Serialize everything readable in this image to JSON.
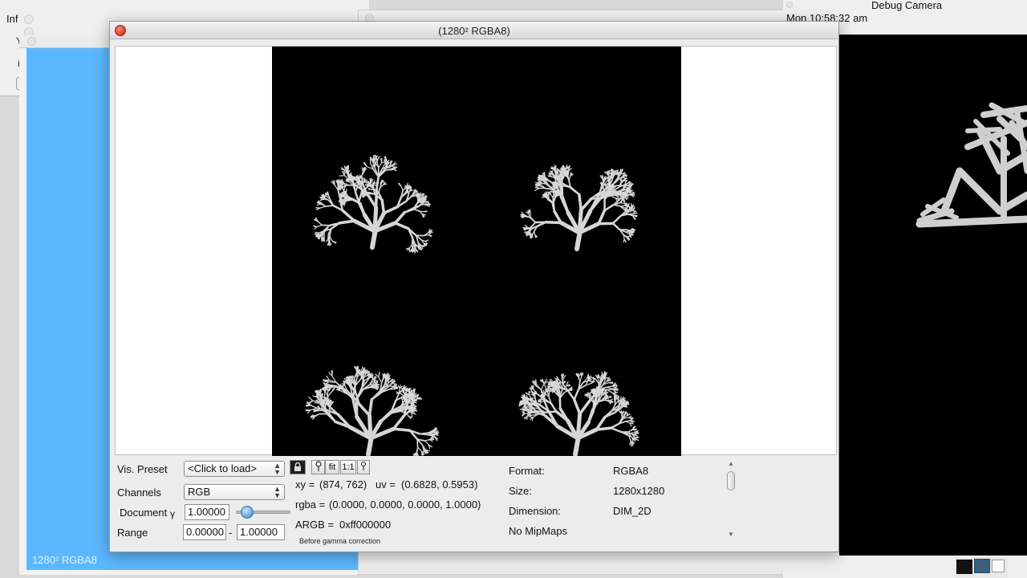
{
  "background": {
    "left_window": {
      "title_fragment": "Inf",
      "glyph_1": "Y",
      "glyph_2": "i"
    },
    "left_window_caption": "1280² RGBA8",
    "right_window": {
      "title": "Debug Camera",
      "clock": "Mon 10:58:32 am"
    }
  },
  "main_window": {
    "title": "(1280² RGBA8)"
  },
  "controls": {
    "vis_preset_label": "Vis. Preset",
    "vis_preset_value": "<Click to load>",
    "channels_label": "Channels",
    "channels_value": "RGB",
    "document_label": "Document",
    "gamma_symbol": "γ",
    "gamma_value": "1.00000",
    "range_label": "Range",
    "range_min": "0.00000",
    "range_sep": "-",
    "range_max": "1.00000",
    "gamma_slider_fraction": 0.2,
    "tool_buttons": {
      "fit": "fit",
      "one_to_one": "1:1"
    }
  },
  "pixel_info": {
    "xy_label": "xy =",
    "xy_value": "(874, 762)",
    "uv_label": "uv =",
    "uv_value": "(0.6828, 0.5953)",
    "rgba_label": "rgba =",
    "rgba_value": "(0.0000, 0.0000, 0.0000, 1.0000)",
    "argb_label": "ARGB =",
    "argb_value": "0xff000000",
    "note": "Before gamma correction"
  },
  "texture_info": {
    "format_label": "Format:",
    "format_value": "RGBA8",
    "size_label": "Size:",
    "size_value": "1280x1280",
    "dimension_label": "Dimension:",
    "dimension_value": "DIM_2D",
    "mipmaps": "No MipMaps"
  },
  "colors": {
    "desktop_blue": "#5bb8ff",
    "close_button": "#d8382a",
    "slider_knob": "#5a9fe0"
  }
}
